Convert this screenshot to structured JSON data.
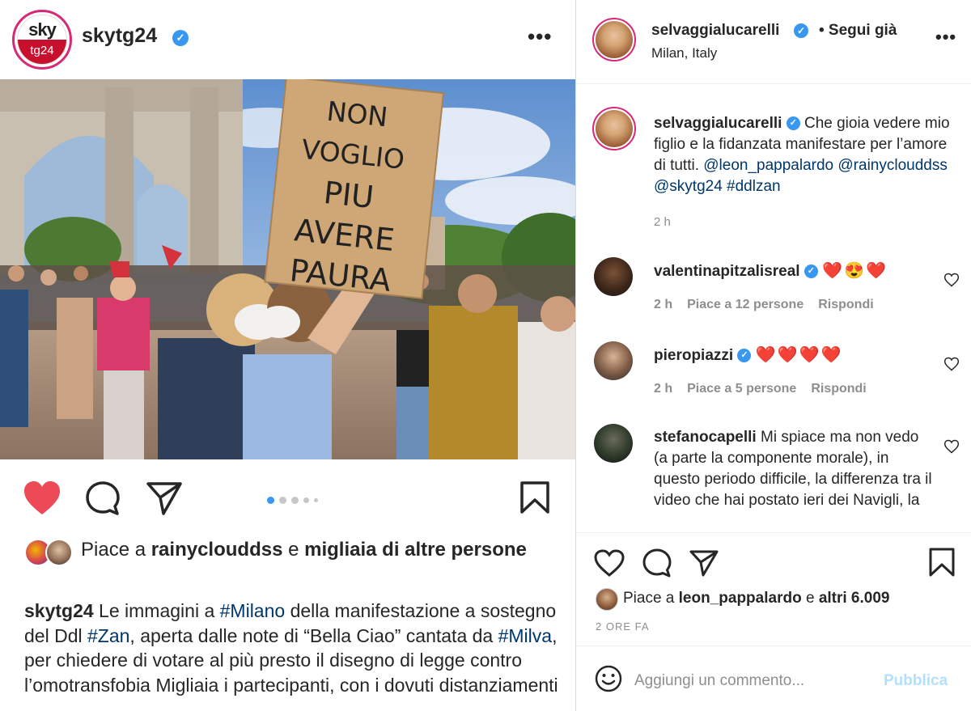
{
  "post": {
    "account": "skytg24",
    "logo_top": "sky",
    "logo_bottom": "tg24",
    "verified_mark": "✓",
    "more_label": "•••",
    "carousel_position": 1,
    "carousel_count": 5,
    "sign_lines": [
      "NON VOGLIO",
      "PIU",
      "AVERE",
      "PAURA"
    ],
    "likes": {
      "prefix": "Piace a ",
      "user": "rainyclouddss",
      "middle": " e ",
      "rest": "migliaia di altre persone"
    },
    "caption": {
      "user": "skytg24",
      "t1": " Le immagini a ",
      "tag1": "#Milano",
      "t2": " della manifestazione a sostegno del Ddl ",
      "tag2": "#Zan",
      "t3": ", aperta dalle note di “Bella Ciao” cantata da ",
      "tag3": "#Milva",
      "t4": ", per chiedere di votare al più presto il disegno di legge contro l’omotransfobia Migliaia i partecipanti, con i dovuti distanziamenti"
    }
  },
  "detail": {
    "header": {
      "user": "selvaggialucarelli",
      "follow": "• Segui già",
      "location": "Milan, Italy"
    },
    "caption": {
      "user": "selvaggialucarelli",
      "text": " Che gioia vedere mio figlio e la fidanzata manifestare per l’amore di tutti. ",
      "mentions": "@leon_pappalardo @rainyclouddss @skytg24 #ddlzan",
      "time": "2 h"
    },
    "comments": [
      {
        "user": "valentinapitzalisreal",
        "text": "❤️😍❤️",
        "time": "2 h",
        "likes": "Piace a 12 persone",
        "reply": "Rispondi"
      },
      {
        "user": "pieropiazzi",
        "text": "❤️❤️❤️❤️",
        "time": "2 h",
        "likes": "Piace a 5 persone",
        "reply": "Rispondi"
      },
      {
        "user": "stefanocapelli",
        "text": " Mi spiace ma non vedo (a parte la componente morale), in questo periodo difficile, la differenza tra il video che hai postato ieri dei Navigli, la"
      }
    ],
    "likes": {
      "prefix": "Piace a ",
      "user": "leon_pappalardo",
      "middle": " e ",
      "rest": "altri 6.009"
    },
    "date": "2 ORE FA",
    "comment_placeholder": "Aggiungi un commento...",
    "publish": "Pubblica"
  },
  "colors": {
    "like_red": "#ed4956",
    "verified_blue": "#3897f0",
    "link_blue": "#00376b",
    "publish_disabled": "#b2dffc",
    "muted": "#8e8e8e"
  },
  "icons": [
    "heart-filled-icon",
    "comment-icon",
    "share-icon",
    "bookmark-icon",
    "heart-outline-icon",
    "emoji-icon",
    "more-icon",
    "verified-icon"
  ]
}
